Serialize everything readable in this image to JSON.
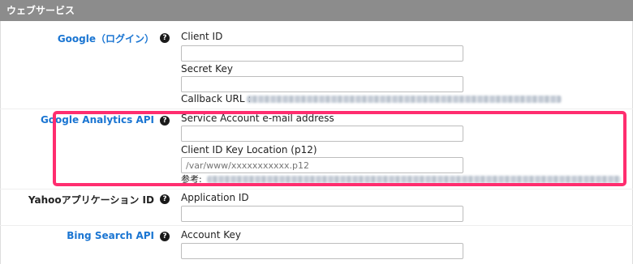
{
  "section": {
    "title": "ウェブサービス"
  },
  "rows": {
    "google": {
      "label": "Google（ログイン）",
      "help": "?",
      "client_id_label": "Client ID",
      "client_id_value": "",
      "secret_key_label": "Secret Key",
      "secret_key_value": "",
      "callback_label": "Callback URL :"
    },
    "analytics": {
      "label": "Google Analytics API",
      "help": "?",
      "service_account_label": "Service Account e-mail address",
      "service_account_value": "",
      "key_location_label": "Client ID Key Location (p12)",
      "key_location_placeholder": "/var/www/xxxxxxxxxxx.p12",
      "reference_label": "参考:"
    },
    "yahoo": {
      "label": "Yahooアプリケーション ID",
      "help": "?",
      "app_id_label": "Application ID",
      "app_id_value": ""
    },
    "bing": {
      "label": "Bing Search API",
      "help": "?",
      "account_key_label": "Account Key",
      "account_key_value": ""
    }
  },
  "colors": {
    "header_bg": "#8c8c8c",
    "link": "#1a75d2",
    "highlight": "#ff2d6f"
  }
}
